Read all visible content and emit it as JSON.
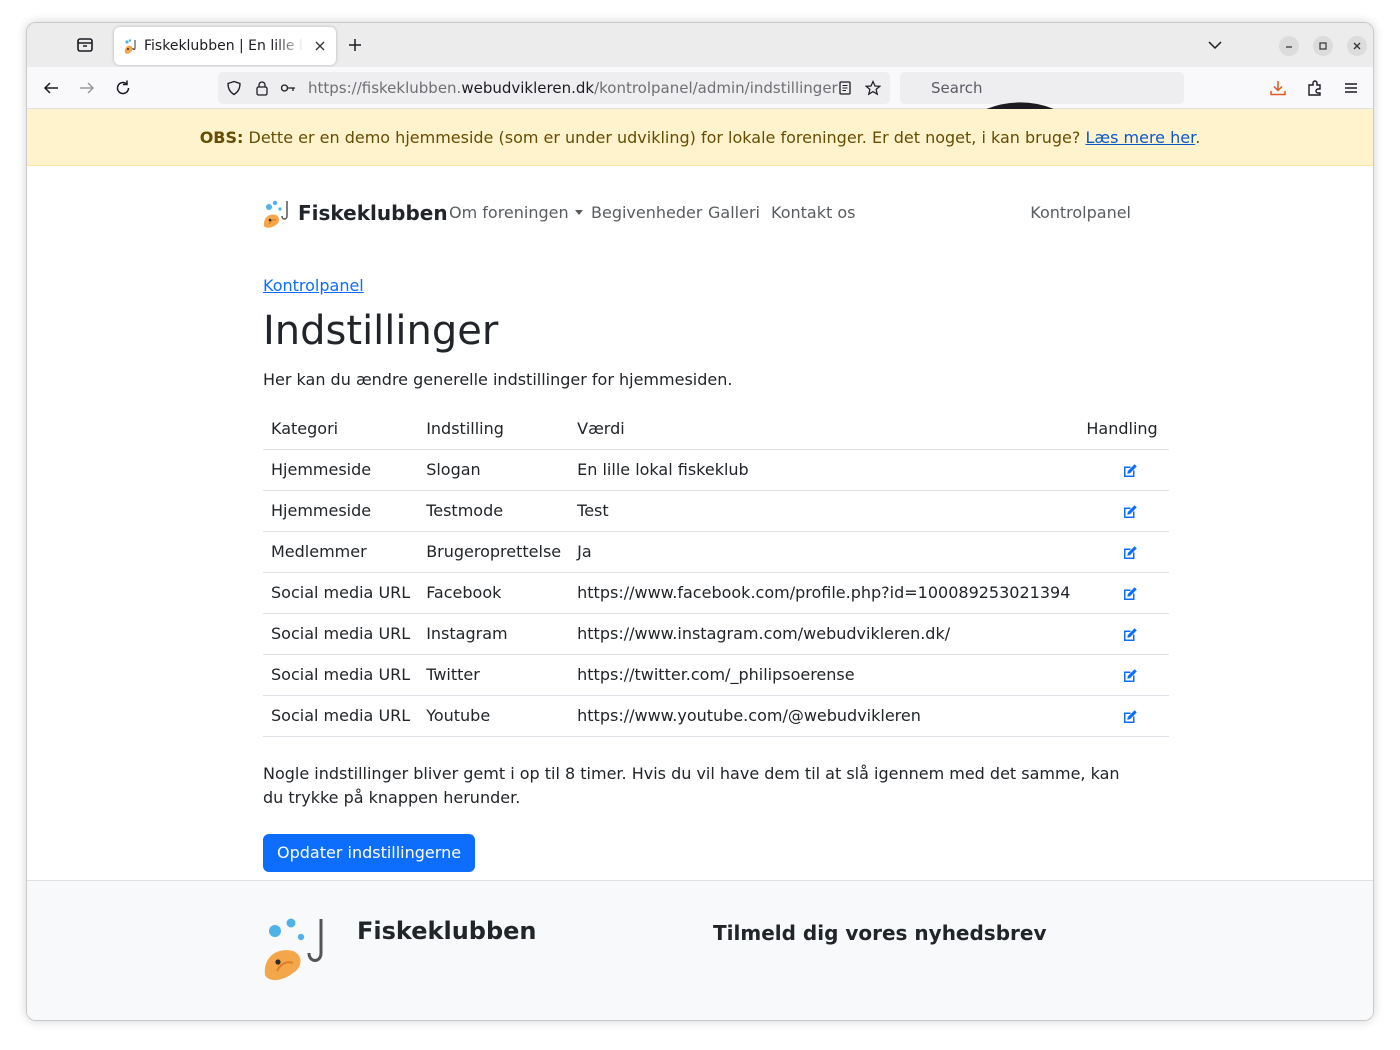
{
  "browser": {
    "tab_title": "Fiskeklubben | En lille lokal fiskeklub",
    "url_prefix": "https://fiskeklubben.",
    "url_domain": "webudvikleren.dk",
    "url_path": "/kontrolpanel/admin/indstillinger",
    "search_placeholder": "Search"
  },
  "banner": {
    "label": "OBS:",
    "text": " Dette er en demo hjemmeside (som er under udvikling) for lokale foreninger. Er det noget, i kan bruge? ",
    "link": "Læs mere her",
    "end": "."
  },
  "site_nav": {
    "brand": "Fiskeklubben",
    "items": [
      "Om foreningen",
      "Begivenheder",
      "Galleri",
      "Kontakt os"
    ],
    "right": "Kontrolpanel"
  },
  "page": {
    "breadcrumb": "Kontrolpanel",
    "title": "Indstillinger",
    "lead": "Her kan du ændre generelle indstillinger for hjemmesiden.",
    "note": "Nogle indstillinger bliver gemt i op til 8 timer. Hvis du vil have dem til at slå igennem med det samme, kan du trykke på knappen herunder.",
    "button": "Opdater indstillingerne"
  },
  "table": {
    "headers": [
      "Kategori",
      "Indstilling",
      "Værdi",
      "Handling"
    ],
    "rows": [
      [
        "Hjemmeside",
        "Slogan",
        "En lille lokal fiskeklub"
      ],
      [
        "Hjemmeside",
        "Testmode",
        "Test"
      ],
      [
        "Medlemmer",
        "Brugeroprettelse",
        "Ja"
      ],
      [
        "Social media URL",
        "Facebook",
        "https://www.facebook.com/profile.php?id=100089253021394"
      ],
      [
        "Social media URL",
        "Instagram",
        "https://www.instagram.com/webudvikleren.dk/"
      ],
      [
        "Social media URL",
        "Twitter",
        "https://twitter.com/_philipsoerense"
      ],
      [
        "Social media URL",
        "Youtube",
        "https://www.youtube.com/@webudvikleren"
      ]
    ]
  },
  "footer": {
    "brand": "Fiskeklubben",
    "newsletter": "Tilmeld dig vores nyhedsbrev"
  },
  "colors": {
    "primary": "#0d6efd",
    "banner_bg": "#fff3cd",
    "banner_text": "#664d03",
    "edit_icon": "#0d6efd"
  },
  "icons": {
    "edit": "pencil-square-icon",
    "logo": "fish-logo-icon"
  }
}
